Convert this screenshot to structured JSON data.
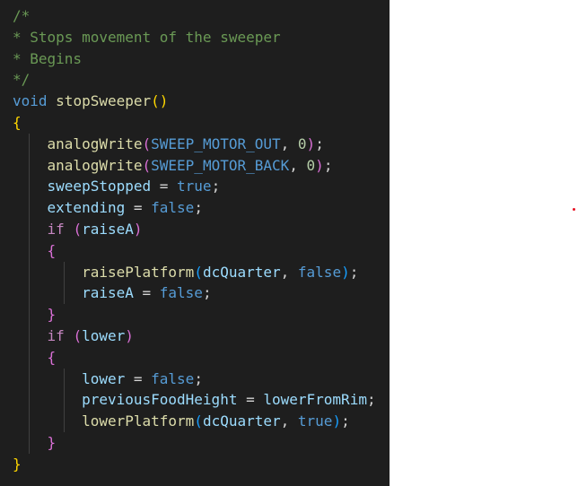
{
  "editor": {
    "lines": [
      [
        {
          "t": "/*",
          "c": "comment"
        }
      ],
      [
        {
          "t": "* Stops movement of the sweeper",
          "c": "comment"
        }
      ],
      [
        {
          "t": "* Begins",
          "c": "comment"
        }
      ],
      [
        {
          "t": "*/",
          "c": "comment"
        }
      ],
      [
        {
          "t": "void",
          "c": "type"
        },
        {
          "t": " ",
          "c": "plain"
        },
        {
          "t": "stopSweeper",
          "c": "func"
        },
        {
          "t": "()",
          "c": "br1"
        }
      ],
      [
        {
          "t": "{",
          "c": "br1"
        }
      ],
      [
        {
          "t": "    ",
          "c": "plain"
        },
        {
          "t": "analogWrite",
          "c": "func"
        },
        {
          "t": "(",
          "c": "br2"
        },
        {
          "t": "SWEEP_MOTOR_OUT",
          "c": "macro"
        },
        {
          "t": ", ",
          "c": "plain"
        },
        {
          "t": "0",
          "c": "num"
        },
        {
          "t": ")",
          "c": "br2"
        },
        {
          "t": ";",
          "c": "plain"
        }
      ],
      [
        {
          "t": "    ",
          "c": "plain"
        },
        {
          "t": "analogWrite",
          "c": "func"
        },
        {
          "t": "(",
          "c": "br2"
        },
        {
          "t": "SWEEP_MOTOR_BACK",
          "c": "macro"
        },
        {
          "t": ", ",
          "c": "plain"
        },
        {
          "t": "0",
          "c": "num"
        },
        {
          "t": ")",
          "c": "br2"
        },
        {
          "t": ";",
          "c": "plain"
        }
      ],
      [
        {
          "t": "    ",
          "c": "plain"
        },
        {
          "t": "sweepStopped",
          "c": "var"
        },
        {
          "t": " = ",
          "c": "plain"
        },
        {
          "t": "true",
          "c": "bool"
        },
        {
          "t": ";",
          "c": "plain"
        }
      ],
      [
        {
          "t": "    ",
          "c": "plain"
        },
        {
          "t": "extending",
          "c": "var"
        },
        {
          "t": " = ",
          "c": "plain"
        },
        {
          "t": "false",
          "c": "bool"
        },
        {
          "t": ";",
          "c": "plain"
        }
      ],
      [
        {
          "t": "    ",
          "c": "plain"
        },
        {
          "t": "if",
          "c": "kw"
        },
        {
          "t": " ",
          "c": "plain"
        },
        {
          "t": "(",
          "c": "br2"
        },
        {
          "t": "raiseA",
          "c": "var"
        },
        {
          "t": ")",
          "c": "br2"
        }
      ],
      [
        {
          "t": "    ",
          "c": "plain"
        },
        {
          "t": "{",
          "c": "br2"
        }
      ],
      [
        {
          "t": "        ",
          "c": "plain"
        },
        {
          "t": "raisePlatform",
          "c": "func"
        },
        {
          "t": "(",
          "c": "br3"
        },
        {
          "t": "dcQuarter",
          "c": "var"
        },
        {
          "t": ", ",
          "c": "plain"
        },
        {
          "t": "false",
          "c": "bool"
        },
        {
          "t": ")",
          "c": "br3"
        },
        {
          "t": ";",
          "c": "plain"
        }
      ],
      [
        {
          "t": "        ",
          "c": "plain"
        },
        {
          "t": "raiseA",
          "c": "var"
        },
        {
          "t": " = ",
          "c": "plain"
        },
        {
          "t": "false",
          "c": "bool"
        },
        {
          "t": ";",
          "c": "plain"
        }
      ],
      [
        {
          "t": "    ",
          "c": "plain"
        },
        {
          "t": "}",
          "c": "br2"
        }
      ],
      [
        {
          "t": "    ",
          "c": "plain"
        },
        {
          "t": "if",
          "c": "kw"
        },
        {
          "t": " ",
          "c": "plain"
        },
        {
          "t": "(",
          "c": "br2"
        },
        {
          "t": "lower",
          "c": "var"
        },
        {
          "t": ")",
          "c": "br2"
        }
      ],
      [
        {
          "t": "    ",
          "c": "plain"
        },
        {
          "t": "{",
          "c": "br2"
        }
      ],
      [
        {
          "t": "        ",
          "c": "plain"
        },
        {
          "t": "lower",
          "c": "var"
        },
        {
          "t": " = ",
          "c": "plain"
        },
        {
          "t": "false",
          "c": "bool"
        },
        {
          "t": ";",
          "c": "plain"
        }
      ],
      [
        {
          "t": "        ",
          "c": "plain"
        },
        {
          "t": "previousFoodHeight",
          "c": "var"
        },
        {
          "t": " = ",
          "c": "plain"
        },
        {
          "t": "lowerFromRim",
          "c": "var"
        },
        {
          "t": ";",
          "c": "plain"
        }
      ],
      [
        {
          "t": "        ",
          "c": "plain"
        },
        {
          "t": "lowerPlatform",
          "c": "func"
        },
        {
          "t": "(",
          "c": "br3"
        },
        {
          "t": "dcQuarter",
          "c": "var"
        },
        {
          "t": ", ",
          "c": "plain"
        },
        {
          "t": "true",
          "c": "bool"
        },
        {
          "t": ")",
          "c": "br3"
        },
        {
          "t": ";",
          "c": "plain"
        }
      ],
      [
        {
          "t": "    ",
          "c": "plain"
        },
        {
          "t": "}",
          "c": "br2"
        }
      ],
      [
        {
          "t": "}",
          "c": "br1"
        }
      ]
    ]
  },
  "colors": {
    "editor_background": "#1e1e1e",
    "page_background": "#ffffff",
    "marker_dot": "#e81123"
  }
}
